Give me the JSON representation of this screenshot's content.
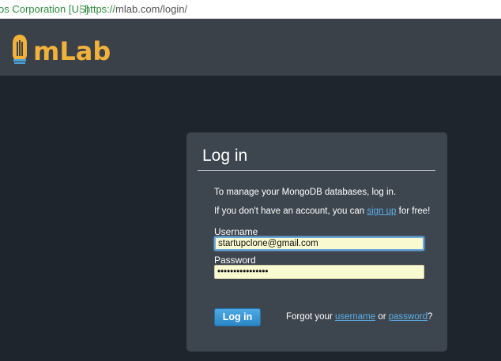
{
  "browser": {
    "org_label": "os Corporation [US]",
    "url_protocol": "https://",
    "url_rest": "mlab.com/login/"
  },
  "header": {
    "logo_text": "mLab",
    "brand_color": "#f2b13a"
  },
  "login": {
    "title": "Log in",
    "intro_line1": "To manage your MongoDB databases, log in.",
    "intro_line2_before": "If you don't have an account, you can ",
    "signup_link": "sign up",
    "intro_line2_after": " for free!",
    "username_label": "Username",
    "username_value": "startupclone@gmail.com",
    "password_label": "Password",
    "password_value": "••••••••••••••••",
    "login_button": "Log in",
    "forgot_before": "Forgot your ",
    "forgot_username_link": "username",
    "forgot_or": " or ",
    "forgot_password_link": "password",
    "forgot_after": "?"
  },
  "colors": {
    "accent": "#2b86c6",
    "link": "#5cb0e8",
    "field_bg": "#fafad0"
  },
  "icons": {
    "logo": "mlab-leaf-logo-icon"
  }
}
